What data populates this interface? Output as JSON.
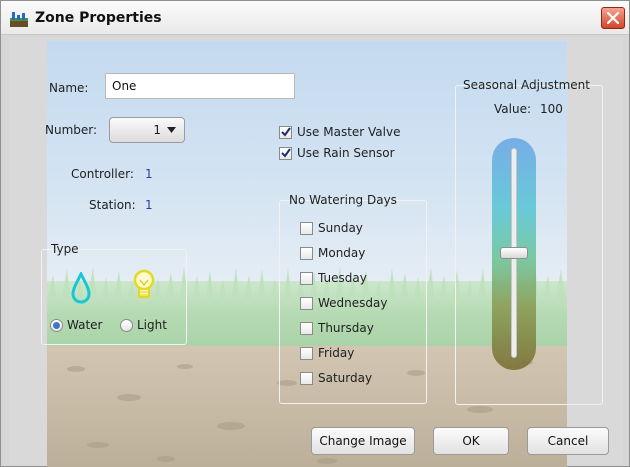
{
  "window": {
    "title": "Zone Properties"
  },
  "form": {
    "name_label": "Name:",
    "name_value": "One",
    "number_label": "Number:",
    "number_value": "1",
    "controller_label": "Controller:",
    "controller_value": "1",
    "station_label": "Station:",
    "station_value": "1"
  },
  "type_group": {
    "title": "Type",
    "options": [
      {
        "label": "Water",
        "selected": true
      },
      {
        "label": "Light",
        "selected": false
      }
    ]
  },
  "valves": [
    {
      "label": "Use Master Valve",
      "checked": true
    },
    {
      "label": "Use Rain Sensor",
      "checked": true
    }
  ],
  "no_watering": {
    "title": "No Watering Days",
    "days": [
      {
        "label": "Sunday",
        "checked": false
      },
      {
        "label": "Monday",
        "checked": false
      },
      {
        "label": "Tuesday",
        "checked": false
      },
      {
        "label": "Wednesday",
        "checked": false
      },
      {
        "label": "Thursday",
        "checked": false
      },
      {
        "label": "Friday",
        "checked": false
      },
      {
        "label": "Saturday",
        "checked": false
      }
    ]
  },
  "seasonal": {
    "title": "Seasonal Adjustment",
    "value_label": "Value:",
    "value": "100",
    "level_fraction": 0.5
  },
  "buttons": {
    "change_image": "Change Image",
    "ok": "OK",
    "cancel": "Cancel"
  },
  "colors": {
    "accent": "#3a77c8",
    "value_text": "#2a3fb0",
    "close": "#d3442a"
  }
}
